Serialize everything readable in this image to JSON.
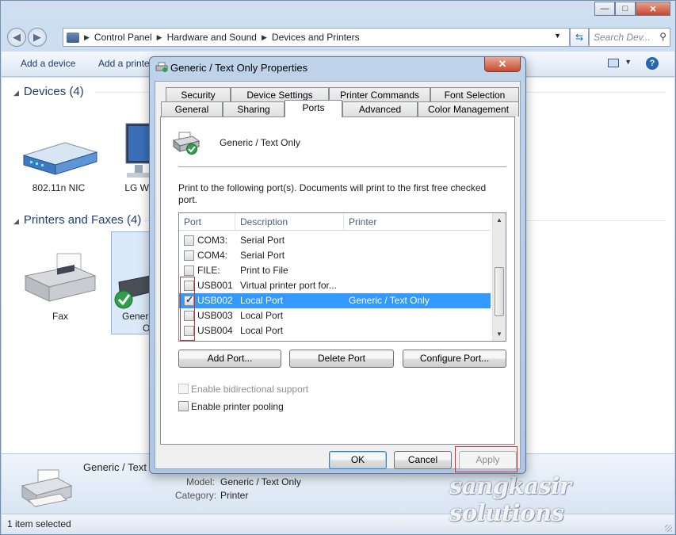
{
  "explorer": {
    "breadcrumb": [
      "Control Panel",
      "Hardware and Sound",
      "Devices and Printers"
    ],
    "search_placeholder": "Search Dev...",
    "commands": {
      "add_device": "Add a device",
      "add_printer": "Add a printe"
    },
    "groups": {
      "devices": {
        "title": "Devices (4)",
        "items": [
          "802.11n NIC",
          "LG W"
        ]
      },
      "printers": {
        "title": "Printers and Faxes (4)",
        "items": [
          "Fax",
          "Gener",
          "O"
        ]
      }
    },
    "details": {
      "name": "Generic / Text",
      "model_label": "Model:",
      "model_value": "Generic / Text Only",
      "category_label": "Category:",
      "category_value": "Printer"
    },
    "status": "1 item selected"
  },
  "dialog": {
    "title": "Generic / Text Only Properties",
    "close_glyph": "✕",
    "tabs_row1": [
      "Security",
      "Device Settings",
      "Printer Commands",
      "Font Selection"
    ],
    "tabs_row2": [
      "General",
      "Sharing",
      "Ports",
      "Advanced",
      "Color Management"
    ],
    "active_tab": "Ports",
    "printer_name": "Generic / Text Only",
    "instructions": "Print to the following port(s). Documents will print to the first free checked port.",
    "columns": {
      "port": "Port",
      "description": "Description",
      "printer": "Printer"
    },
    "ports": [
      {
        "port": "COM3:",
        "description": "Serial Port",
        "printer": "",
        "checked": false
      },
      {
        "port": "COM4:",
        "description": "Serial Port",
        "printer": "",
        "checked": false
      },
      {
        "port": "FILE:",
        "description": "Print to File",
        "printer": "",
        "checked": false
      },
      {
        "port": "USB001",
        "description": "Virtual printer port for...",
        "printer": "",
        "checked": false
      },
      {
        "port": "USB002",
        "description": "Local Port",
        "printer": "Generic / Text Only",
        "checked": true
      },
      {
        "port": "USB003",
        "description": "Local Port",
        "printer": "",
        "checked": false
      },
      {
        "port": "USB004",
        "description": "Local Port",
        "printer": "",
        "checked": false
      }
    ],
    "buttons": {
      "add_port": "Add Port...",
      "delete_port": "Delete Port",
      "configure_port": "Configure Port..."
    },
    "checkboxes": {
      "bidirectional": "Enable bidirectional support",
      "pooling": "Enable printer pooling"
    },
    "footer": {
      "ok": "OK",
      "cancel": "Cancel",
      "apply": "Apply"
    }
  },
  "watermark": "sangkasir solutions",
  "colors": {
    "selection": "#3399ff",
    "highlight_box": "#d23030",
    "accent": "#1e3d76"
  }
}
